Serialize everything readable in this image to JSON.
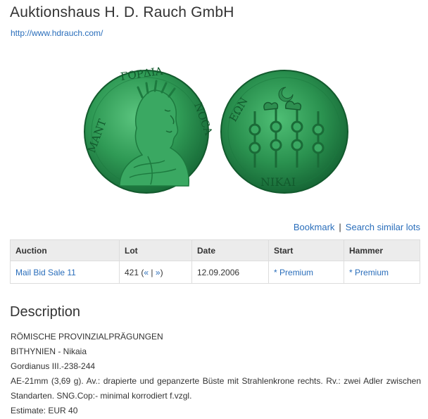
{
  "header": {
    "title": "Auktionshaus H. D. Rauch GmbH",
    "url": "http://www.hdrauch.com/"
  },
  "actions": {
    "bookmark": "Bookmark",
    "separator": "|",
    "search_similar": "Search similar lots"
  },
  "table": {
    "headers": [
      "Auction",
      "Lot",
      "Date",
      "Start",
      "Hammer"
    ],
    "row": {
      "auction": "Mail Bid Sale 11",
      "lot_number": "421",
      "lot_open": "(",
      "prev": "«",
      "lot_sep": "|",
      "next": "»",
      "lot_close": ")",
      "date": "12.09.2006",
      "start_prefix": "*",
      "start_link": "Premium",
      "hammer_prefix": "*",
      "hammer_link": "Premium"
    }
  },
  "description": {
    "heading": "Description",
    "lines": [
      "RÖMISCHE PROVINZIALPRÄGUNGEN",
      "BITHYNIEN - Nikaia",
      "Gordianus III.-238-244",
      "AE-21mm (3,69 g). Av.: drapierte und gepanzerte Büste mit Strahlenkrone rechts. Rv.: zwei Adler zwischen Standarten. SNG.Cop:- minimal korrodiert f.vzgl.",
      "Estimate: EUR 40"
    ]
  },
  "colors": {
    "link": "#2a6ebb",
    "text": "#333333",
    "table_header_bg": "#ececec",
    "coin_patina": "#2f9a55"
  }
}
